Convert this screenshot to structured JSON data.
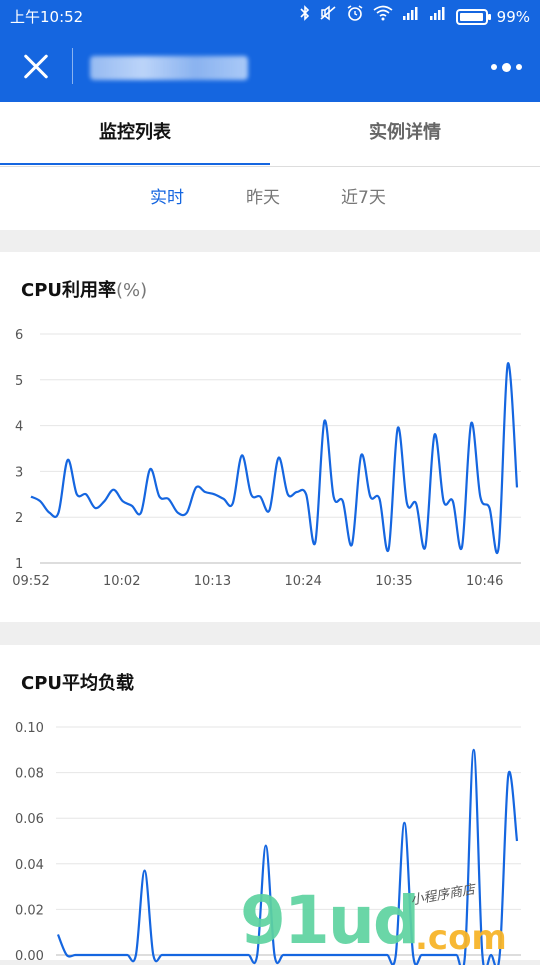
{
  "status_bar": {
    "time": "上午10:52",
    "icons": [
      "bluetooth-icon",
      "mute-icon",
      "alarm-icon",
      "wifi-icon",
      "signal-icon",
      "signal-icon",
      "battery-icon"
    ],
    "battery": "99%",
    "battery_level": 0.99
  },
  "nav": {
    "title_blurred": true
  },
  "tabs": [
    {
      "label": "监控列表",
      "active": true
    },
    {
      "label": "实例详情",
      "active": false
    }
  ],
  "periods": [
    {
      "label": "实时",
      "selected": true
    },
    {
      "label": "昨天",
      "selected": false
    },
    {
      "label": "近7天",
      "selected": false
    }
  ],
  "chart_data": [
    {
      "type": "line",
      "title": "CPU利用率",
      "unit": "(%)",
      "ylim": [
        1,
        6
      ],
      "yticks": [
        "6",
        "5",
        "4",
        "3",
        "2",
        "1"
      ],
      "xticks": [
        "09:52",
        "10:02",
        "10:13",
        "10:24",
        "10:35",
        "10:46"
      ],
      "color": "#1566e0",
      "grid": true,
      "values": [
        2.45,
        2.35,
        2.1,
        2.1,
        3.25,
        2.5,
        2.5,
        2.2,
        2.35,
        2.6,
        2.35,
        2.25,
        2.1,
        3.05,
        2.45,
        2.4,
        2.1,
        2.1,
        2.65,
        2.55,
        2.5,
        2.4,
        2.3,
        3.35,
        2.5,
        2.45,
        2.15,
        3.3,
        2.5,
        2.55,
        2.5,
        1.45,
        4.1,
        2.45,
        2.35,
        1.4,
        3.35,
        2.45,
        2.4,
        1.3,
        3.95,
        2.3,
        2.3,
        1.35,
        3.8,
        2.35,
        2.35,
        1.35,
        4.05,
        2.45,
        2.2,
        1.35,
        5.35,
        2.65
      ]
    },
    {
      "type": "line",
      "title": "CPU平均负载",
      "ylim": [
        0,
        0.1
      ],
      "yticks": [
        "0.10",
        "0.08",
        "0.06",
        "0.04",
        "0.02",
        "0.00"
      ],
      "color": "#1566e0",
      "grid": true,
      "values": [
        0.009,
        0.0,
        0.0,
        0.0,
        0.0,
        0.0,
        0.0,
        0.0,
        0.0,
        0.0,
        0.037,
        0.0,
        0.0,
        0.0,
        0.0,
        0.0,
        0.0,
        0.0,
        0.0,
        0.0,
        0.0,
        0.0,
        0.0,
        0.0,
        0.048,
        0.0,
        0.0,
        0.0,
        0.0,
        0.0,
        0.0,
        0.0,
        0.0,
        0.0,
        0.0,
        0.0,
        0.0,
        0.0,
        0.0,
        0.0,
        0.058,
        0.0,
        0.0,
        0.0,
        0.0,
        0.0,
        0.0,
        0.0,
        0.09,
        0.0,
        0.0,
        0.0,
        0.079,
        0.05
      ]
    }
  ],
  "watermark": {
    "main": "91ud",
    "suffix": ".com",
    "small": "小程序商店"
  }
}
